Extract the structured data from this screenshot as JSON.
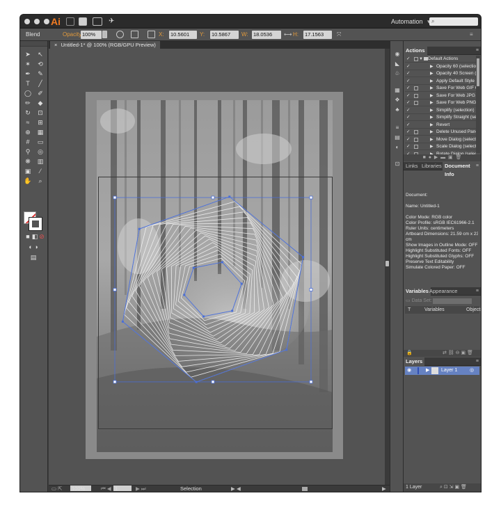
{
  "app": {
    "logo": "Ai",
    "workspace": "Automation",
    "workspace_caret": "▾",
    "search_icon": "⌕"
  },
  "control_bar": {
    "blend_label": "Blend",
    "opacity_label": "Opacity:",
    "opacity_value": "100%",
    "x_label": "X:",
    "x_value": "10.5601 cm",
    "y_label": "Y:",
    "y_value": "10.5867 cm",
    "w_label": "W:",
    "w_value": "18.0536 cm",
    "h_label": "H:",
    "h_value": "17.1563 cm"
  },
  "document_tab": {
    "close": "×",
    "title": "Untitled-1* @ 100% (RGB/GPU Preview)"
  },
  "status_bar": {
    "zoom": "100%",
    "page": "1",
    "tool": "Selection"
  },
  "actions_panel": {
    "tab": "Actions",
    "set_name": "Default Actions",
    "items": [
      {
        "name": "Opacity 60 (selection)",
        "dialog": false
      },
      {
        "name": "Opacity 40 Screen (selection)",
        "dialog": false
      },
      {
        "name": "Apply Default Style (selection)",
        "dialog": false
      },
      {
        "name": "Save For Web GIF 64 Dithered",
        "dialog": true
      },
      {
        "name": "Save For Web JPG Medium",
        "dialog": true
      },
      {
        "name": "Save For Web PNG 24",
        "dialog": true
      },
      {
        "name": "Simplify (selection)",
        "dialog": false
      },
      {
        "name": "Simplify Straight (selection)",
        "dialog": false
      },
      {
        "name": "Revert",
        "dialog": false
      },
      {
        "name": "Delete Unused Panel Items",
        "dialog": true
      },
      {
        "name": "Move Dialog (selection)",
        "dialog": true
      },
      {
        "name": "Scale Dialog (selection)",
        "dialog": true
      },
      {
        "name": "Rotate Dialog (selection)",
        "dialog": true
      }
    ]
  },
  "info_panel": {
    "tabs": [
      "Links",
      "Libraries",
      "Document Info"
    ],
    "lines": [
      "Document:",
      "",
      "Name: Untitled-1",
      "",
      "Color Mode: RGB color",
      "Color Profile: sRGB IEC61966-2.1",
      "Ruler Units: centimeters",
      "Artboard Dimensions: 21.59 cm x 23.4448",
      "cm",
      "Show Images in Outline Mode: OFF",
      "Highlight Substituted Fonts: OFF",
      "Highlight Substituted Glyphs: OFF",
      "Preserve Text Editability",
      "Simulate Colored Paper: OFF"
    ]
  },
  "variables_panel": {
    "tabs": [
      "Variables",
      "Appearance"
    ],
    "data_set_label": "Data Set:",
    "col_variables": "Variables",
    "col_objects": "Objects"
  },
  "layers_panel": {
    "tab": "Layers",
    "layer_name": "Layer 1",
    "footer": "1 Layer"
  },
  "colors": {
    "selection": "#4b6fd6",
    "orange_label": "#e29a3c"
  }
}
